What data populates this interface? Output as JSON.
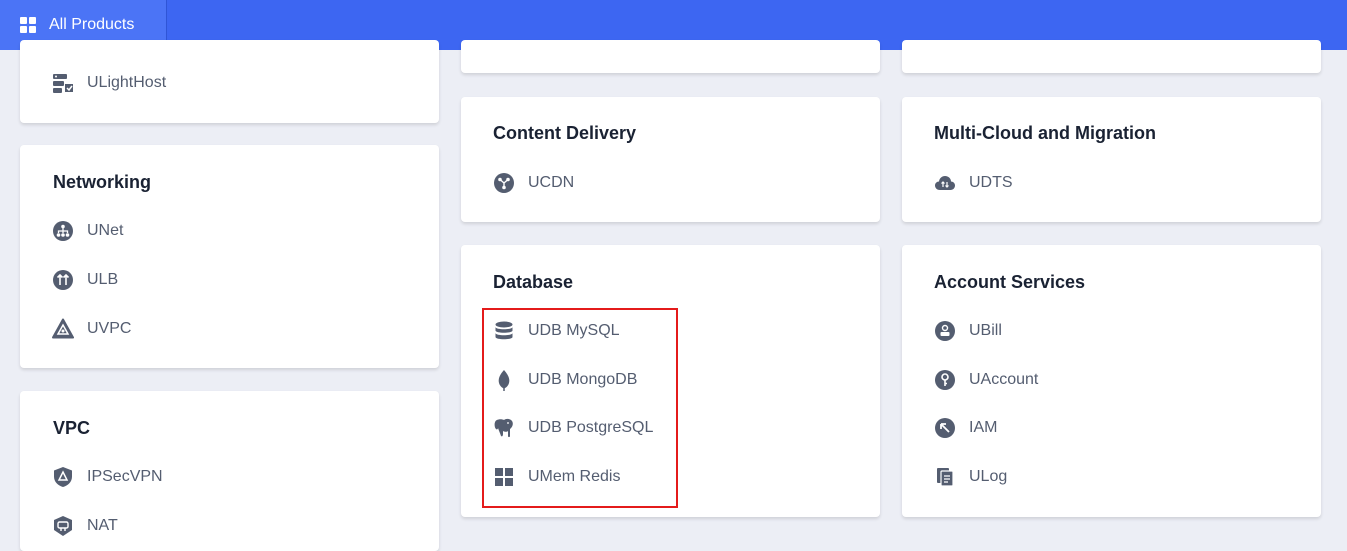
{
  "header": {
    "all_products_label": "All Products"
  },
  "cards": {
    "compute_partial": {
      "items": [
        "ULightHost"
      ]
    },
    "networking": {
      "title": "Networking",
      "items": [
        "UNet",
        "ULB",
        "UVPC"
      ]
    },
    "vpc": {
      "title": "VPC",
      "items": [
        "IPSecVPN",
        "NAT"
      ]
    },
    "content_delivery": {
      "title": "Content Delivery",
      "items": [
        "UCDN"
      ]
    },
    "database": {
      "title": "Database",
      "items": [
        "UDB MySQL",
        "UDB MongoDB",
        "UDB PostgreSQL",
        "UMem Redis"
      ]
    },
    "multicloud": {
      "title": "Multi-Cloud and Migration",
      "items": [
        "UDTS"
      ]
    },
    "account": {
      "title": "Account Services",
      "items": [
        "UBill",
        "UAccount",
        "IAM",
        "ULog"
      ]
    }
  },
  "icons": {
    "ulighthost": "server-icon",
    "unet": "network-tree-icon",
    "ulb": "load-balancer-icon",
    "uvpc": "vpc-triangle-icon",
    "ipsecvpn": "shield-icon",
    "nat": "nat-shield-icon",
    "ucdn": "cdn-icon",
    "udb_mysql": "database-icon",
    "udb_mongodb": "leaf-icon",
    "udb_postgresql": "elephant-icon",
    "umem_redis": "grid-icon",
    "udts": "cloud-upload-icon",
    "ubill": "bill-icon",
    "uaccount": "key-icon",
    "iam": "arrow-cursor-icon",
    "ulog": "log-document-icon"
  },
  "colors": {
    "header_bg": "#3d66f2",
    "icon": "#545d70",
    "highlight": "#e41b1b"
  }
}
